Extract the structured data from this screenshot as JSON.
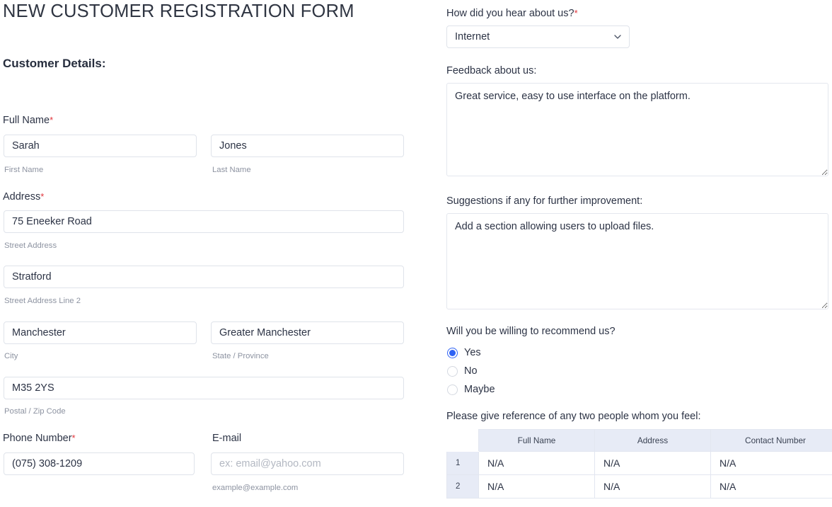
{
  "form": {
    "title": "NEW CUSTOMER REGISTRATION FORM",
    "section_title": "Customer Details:",
    "required_marker": "*"
  },
  "colors": {
    "accent": "#2f63f4",
    "required": "#e1353b",
    "text": "#2c3345",
    "sub_text": "#8d93a1",
    "border": "#dfe3ea",
    "table_header_bg": "#e7ebf6"
  },
  "left": {
    "full_name": {
      "label": "Full Name",
      "required": true,
      "first": {
        "value": "Sarah",
        "sub_label": "First Name",
        "placeholder": ""
      },
      "last": {
        "value": "Jones",
        "sub_label": "Last Name",
        "placeholder": ""
      }
    },
    "address": {
      "label": "Address",
      "required": true,
      "street": {
        "value": "75 Eneeker Road",
        "sub_label": "Street Address",
        "placeholder": ""
      },
      "street2": {
        "value": "Stratford",
        "sub_label": "Street Address Line 2",
        "placeholder": ""
      },
      "city": {
        "value": "Manchester",
        "sub_label": "City",
        "placeholder": ""
      },
      "state": {
        "value": "Greater Manchester",
        "sub_label": "State / Province",
        "placeholder": ""
      },
      "postal": {
        "value": "M35 2YS",
        "sub_label": "Postal / Zip Code",
        "placeholder": ""
      }
    },
    "phone": {
      "label": "Phone Number",
      "required": true,
      "value": "(075) 308-1209",
      "placeholder": ""
    },
    "email": {
      "label": "E-mail",
      "required": false,
      "value": "",
      "placeholder": "ex: email@yahoo.com",
      "sub_label": "example@example.com"
    }
  },
  "right": {
    "hear_about": {
      "label": "How did you hear about us?",
      "required": true,
      "selected": "Internet",
      "options": [
        "Internet"
      ]
    },
    "feedback": {
      "label": "Feedback about us:",
      "value": "Great service, easy to use interface on the platform.",
      "placeholder": ""
    },
    "suggestions": {
      "label": "Suggestions if any for further improvement:",
      "value": "Add a section allowing users to upload files.",
      "placeholder": ""
    },
    "recommend": {
      "label": "Will you be willing to recommend us?",
      "options": [
        {
          "label": "Yes",
          "selected": true
        },
        {
          "label": "No",
          "selected": false
        },
        {
          "label": "Maybe",
          "selected": false
        }
      ]
    },
    "reference": {
      "label": "Please give reference of any two people whom you feel:",
      "corner_header": "",
      "columns": [
        "Full Name",
        "Address",
        "Contact Number"
      ],
      "rows": [
        {
          "num": "1",
          "cells": [
            "N/A",
            "N/A",
            "N/A"
          ]
        },
        {
          "num": "2",
          "cells": [
            "N/A",
            "N/A",
            "N/A"
          ]
        }
      ]
    }
  }
}
